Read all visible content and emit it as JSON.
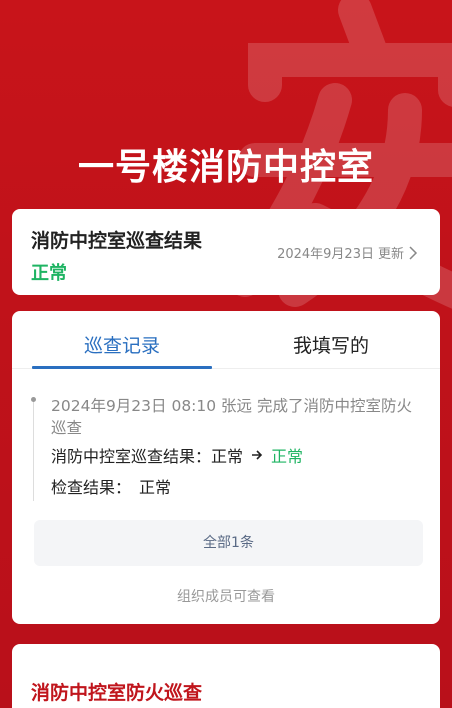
{
  "header": {
    "title": "一号楼消防中控室"
  },
  "result_card": {
    "title": "消防中控室巡查结果",
    "status": "正常",
    "updated_date": "2024年9月23日",
    "updated_label": "更新"
  },
  "records_card": {
    "tabs": [
      {
        "label": "巡查记录",
        "active": true
      },
      {
        "label": "我填写的",
        "active": false
      }
    ],
    "entry": {
      "header": "2024年9月23日 08:10  张远  完成了消防中控室防火巡查",
      "result_label": "消防中控室巡查结果：",
      "result_from": "正常",
      "result_to": "正常",
      "check_label": "检查结果：",
      "check_value": "正常"
    },
    "all_button": "全部1条",
    "footnote": "组织成员可查看"
  },
  "inspect_card": {
    "title": "消防中控室防火巡查"
  },
  "colors": {
    "background": "#c0121a",
    "accent_blue": "#2a6fc0",
    "status_green": "#1fb463",
    "title_red": "#c0151c"
  }
}
